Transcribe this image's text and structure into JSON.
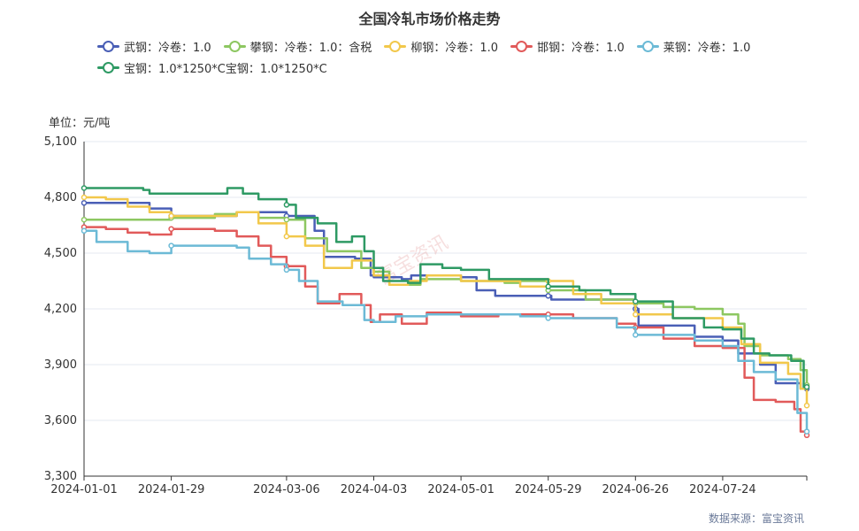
{
  "chart_data": {
    "type": "line",
    "title": "全国冷轧市场价格走势",
    "unit_label": "单位：元/吨",
    "source": "数据来源：富宝资讯",
    "watermark": "富宝资讯",
    "ylim": [
      3300,
      5100
    ],
    "yticks": [
      "3,300",
      "3,600",
      "3,900",
      "4,200",
      "4,500",
      "4,800",
      "5,100"
    ],
    "ytick_values": [
      3300,
      3600,
      3900,
      4200,
      4500,
      4800,
      5100
    ],
    "xlim": [
      "2024-01-01",
      "2024-08-20"
    ],
    "xticks": [
      "2024-01-01",
      "2024-01-29",
      "2024-03-06",
      "2024-04-03",
      "2024-05-01",
      "2024-05-29",
      "2024-06-26",
      "2024-07-24"
    ],
    "grid": true,
    "legend_position": "top",
    "series": [
      {
        "name": "武钢：冷卷：1.0",
        "color": "#4a5fb6",
        "points": [
          [
            "2024-01-01",
            4770
          ],
          [
            "2024-01-15",
            4770
          ],
          [
            "2024-01-22",
            4740
          ],
          [
            "2024-01-29",
            4700
          ],
          [
            "2024-02-19",
            4720
          ],
          [
            "2024-03-06",
            4700
          ],
          [
            "2024-03-15",
            4620
          ],
          [
            "2024-03-18",
            4480
          ],
          [
            "2024-03-28",
            4470
          ],
          [
            "2024-04-02",
            4380
          ],
          [
            "2024-04-03",
            4370
          ],
          [
            "2024-04-12",
            4360
          ],
          [
            "2024-04-15",
            4380
          ],
          [
            "2024-05-01",
            4370
          ],
          [
            "2024-05-06",
            4300
          ],
          [
            "2024-05-12",
            4270
          ],
          [
            "2024-05-29",
            4270
          ],
          [
            "2024-05-30",
            4250
          ],
          [
            "2024-06-20",
            4250
          ],
          [
            "2024-06-26",
            4200
          ],
          [
            "2024-06-27",
            4110
          ],
          [
            "2024-07-10",
            4110
          ],
          [
            "2024-07-15",
            4050
          ],
          [
            "2024-07-24",
            4030
          ],
          [
            "2024-07-29",
            3960
          ],
          [
            "2024-08-05",
            3900
          ],
          [
            "2024-08-10",
            3800
          ],
          [
            "2024-08-17",
            3800
          ],
          [
            "2024-08-18",
            3770
          ],
          [
            "2024-08-20",
            3770
          ]
        ]
      },
      {
        "name": "攀钢：冷卷：1.0：含税",
        "color": "#8dc761",
        "points": [
          [
            "2024-01-01",
            4680
          ],
          [
            "2024-01-22",
            4680
          ],
          [
            "2024-01-29",
            4690
          ],
          [
            "2024-02-12",
            4710
          ],
          [
            "2024-02-19",
            4720
          ],
          [
            "2024-02-26",
            4690
          ],
          [
            "2024-03-06",
            4680
          ],
          [
            "2024-03-12",
            4580
          ],
          [
            "2024-03-19",
            4510
          ],
          [
            "2024-03-30",
            4420
          ],
          [
            "2024-04-03",
            4400
          ],
          [
            "2024-04-08",
            4330
          ],
          [
            "2024-04-18",
            4360
          ],
          [
            "2024-05-01",
            4350
          ],
          [
            "2024-05-15",
            4340
          ],
          [
            "2024-05-20",
            4350
          ],
          [
            "2024-05-29",
            4300
          ],
          [
            "2024-06-10",
            4250
          ],
          [
            "2024-06-26",
            4230
          ],
          [
            "2024-07-05",
            4210
          ],
          [
            "2024-07-15",
            4200
          ],
          [
            "2024-07-24",
            4170
          ],
          [
            "2024-07-29",
            4120
          ],
          [
            "2024-07-31",
            4000
          ],
          [
            "2024-08-05",
            3950
          ],
          [
            "2024-08-14",
            3930
          ],
          [
            "2024-08-18",
            3870
          ],
          [
            "2024-08-20",
            3790
          ]
        ]
      },
      {
        "name": "柳钢：冷卷：1.0",
        "color": "#f2c84b",
        "points": [
          [
            "2024-01-01",
            4800
          ],
          [
            "2024-01-08",
            4790
          ],
          [
            "2024-01-15",
            4750
          ],
          [
            "2024-01-22",
            4720
          ],
          [
            "2024-01-29",
            4700
          ],
          [
            "2024-02-07",
            4700
          ],
          [
            "2024-02-19",
            4720
          ],
          [
            "2024-02-26",
            4660
          ],
          [
            "2024-03-06",
            4590
          ],
          [
            "2024-03-12",
            4540
          ],
          [
            "2024-03-18",
            4420
          ],
          [
            "2024-03-27",
            4460
          ],
          [
            "2024-04-03",
            4380
          ],
          [
            "2024-04-08",
            4330
          ],
          [
            "2024-04-14",
            4350
          ],
          [
            "2024-04-20",
            4380
          ],
          [
            "2024-05-01",
            4350
          ],
          [
            "2024-05-15",
            4350
          ],
          [
            "2024-05-20",
            4320
          ],
          [
            "2024-05-29",
            4350
          ],
          [
            "2024-06-06",
            4280
          ],
          [
            "2024-06-15",
            4230
          ],
          [
            "2024-06-26",
            4170
          ],
          [
            "2024-07-08",
            4150
          ],
          [
            "2024-07-24",
            4100
          ],
          [
            "2024-07-30",
            4010
          ],
          [
            "2024-08-05",
            3910
          ],
          [
            "2024-08-14",
            3850
          ],
          [
            "2024-08-18",
            3770
          ],
          [
            "2024-08-20",
            3680
          ]
        ]
      },
      {
        "name": "邯钢：冷卷：1.0",
        "color": "#e15a5a",
        "points": [
          [
            "2024-01-01",
            4640
          ],
          [
            "2024-01-08",
            4630
          ],
          [
            "2024-01-15",
            4610
          ],
          [
            "2024-01-22",
            4600
          ],
          [
            "2024-01-29",
            4630
          ],
          [
            "2024-02-12",
            4620
          ],
          [
            "2024-02-19",
            4590
          ],
          [
            "2024-02-26",
            4540
          ],
          [
            "2024-03-01",
            4480
          ],
          [
            "2024-03-06",
            4430
          ],
          [
            "2024-03-12",
            4320
          ],
          [
            "2024-03-16",
            4230
          ],
          [
            "2024-03-23",
            4280
          ],
          [
            "2024-03-30",
            4220
          ],
          [
            "2024-04-02",
            4130
          ],
          [
            "2024-04-05",
            4170
          ],
          [
            "2024-04-12",
            4120
          ],
          [
            "2024-04-20",
            4180
          ],
          [
            "2024-05-01",
            4160
          ],
          [
            "2024-05-13",
            4170
          ],
          [
            "2024-05-29",
            4170
          ],
          [
            "2024-06-06",
            4150
          ],
          [
            "2024-06-20",
            4120
          ],
          [
            "2024-06-26",
            4100
          ],
          [
            "2024-07-05",
            4040
          ],
          [
            "2024-07-15",
            4000
          ],
          [
            "2024-07-24",
            3990
          ],
          [
            "2024-07-31",
            3830
          ],
          [
            "2024-08-03",
            3710
          ],
          [
            "2024-08-10",
            3700
          ],
          [
            "2024-08-16",
            3660
          ],
          [
            "2024-08-18",
            3540
          ],
          [
            "2024-08-20",
            3520
          ]
        ]
      },
      {
        "name": "莱钢：冷卷：1.0",
        "color": "#6cbad6",
        "points": [
          [
            "2024-01-01",
            4620
          ],
          [
            "2024-01-05",
            4560
          ],
          [
            "2024-01-15",
            4510
          ],
          [
            "2024-01-22",
            4500
          ],
          [
            "2024-01-29",
            4540
          ],
          [
            "2024-02-19",
            4530
          ],
          [
            "2024-02-23",
            4470
          ],
          [
            "2024-03-01",
            4440
          ],
          [
            "2024-03-06",
            4410
          ],
          [
            "2024-03-10",
            4350
          ],
          [
            "2024-03-16",
            4240
          ],
          [
            "2024-03-24",
            4220
          ],
          [
            "2024-03-31",
            4140
          ],
          [
            "2024-04-03",
            4130
          ],
          [
            "2024-04-10",
            4160
          ],
          [
            "2024-04-20",
            4170
          ],
          [
            "2024-05-01",
            4170
          ],
          [
            "2024-05-20",
            4160
          ],
          [
            "2024-05-29",
            4150
          ],
          [
            "2024-06-10",
            4150
          ],
          [
            "2024-06-20",
            4100
          ],
          [
            "2024-06-26",
            4060
          ],
          [
            "2024-07-05",
            4060
          ],
          [
            "2024-07-15",
            4030
          ],
          [
            "2024-07-24",
            4000
          ],
          [
            "2024-07-29",
            3920
          ],
          [
            "2024-08-03",
            3860
          ],
          [
            "2024-08-10",
            3820
          ],
          [
            "2024-08-17",
            3640
          ],
          [
            "2024-08-20",
            3540
          ]
        ]
      },
      {
        "name": "宝钢：1.0*1250*C宝钢：1.0*1250*C",
        "color": "#2e9a64",
        "points": [
          [
            "2024-01-01",
            4850
          ],
          [
            "2024-01-20",
            4840
          ],
          [
            "2024-01-22",
            4820
          ],
          [
            "2024-02-12",
            4820
          ],
          [
            "2024-02-16",
            4850
          ],
          [
            "2024-02-21",
            4820
          ],
          [
            "2024-02-26",
            4790
          ],
          [
            "2024-03-06",
            4760
          ],
          [
            "2024-03-09",
            4690
          ],
          [
            "2024-03-16",
            4660
          ],
          [
            "2024-03-22",
            4560
          ],
          [
            "2024-03-27",
            4590
          ],
          [
            "2024-03-31",
            4510
          ],
          [
            "2024-04-03",
            4420
          ],
          [
            "2024-04-06",
            4350
          ],
          [
            "2024-04-14",
            4340
          ],
          [
            "2024-04-18",
            4440
          ],
          [
            "2024-04-25",
            4420
          ],
          [
            "2024-05-01",
            4410
          ],
          [
            "2024-05-10",
            4360
          ],
          [
            "2024-05-20",
            4360
          ],
          [
            "2024-05-29",
            4320
          ],
          [
            "2024-06-08",
            4300
          ],
          [
            "2024-06-18",
            4280
          ],
          [
            "2024-06-26",
            4240
          ],
          [
            "2024-07-08",
            4150
          ],
          [
            "2024-07-18",
            4100
          ],
          [
            "2024-07-24",
            4090
          ],
          [
            "2024-07-30",
            4040
          ],
          [
            "2024-08-03",
            3960
          ],
          [
            "2024-08-08",
            3950
          ],
          [
            "2024-08-15",
            3920
          ],
          [
            "2024-08-19",
            3780
          ],
          [
            "2024-08-20",
            3780
          ]
        ]
      }
    ]
  }
}
